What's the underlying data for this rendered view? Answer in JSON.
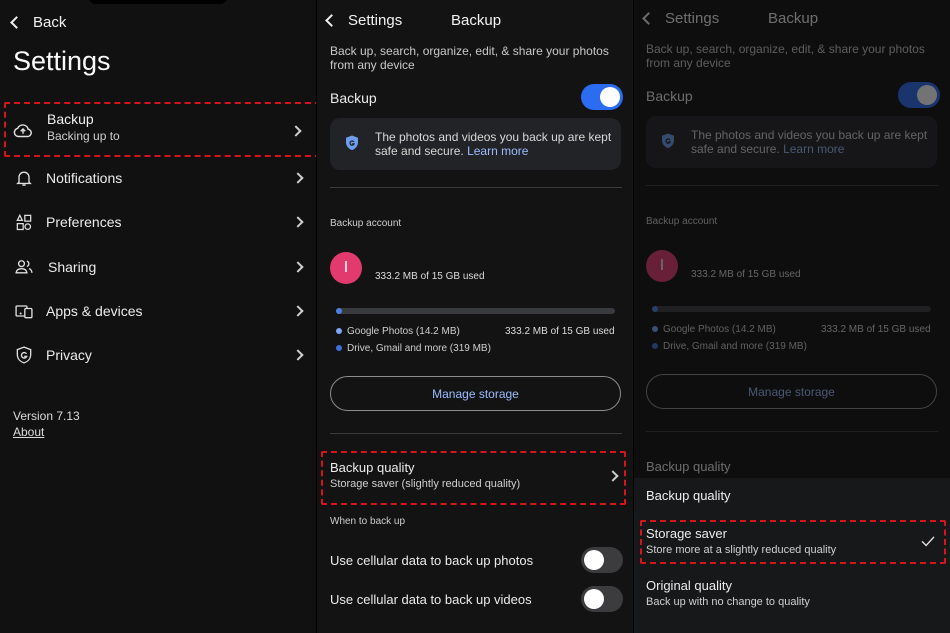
{
  "settings": {
    "back_label": "Back",
    "title": "Settings",
    "items": [
      {
        "label": "Backup",
        "sublabel": "Backing up to",
        "icon": "cloud-upload-icon"
      },
      {
        "label": "Notifications",
        "icon": "bell-icon"
      },
      {
        "label": "Preferences",
        "icon": "shapes-icon"
      },
      {
        "label": "Sharing",
        "icon": "people-icon"
      },
      {
        "label": "Apps & devices",
        "icon": "devices-icon"
      },
      {
        "label": "Privacy",
        "icon": "shield-g-icon"
      }
    ],
    "version": "Version 7.13",
    "about": "About"
  },
  "backup": {
    "back_label": "Settings",
    "title": "Backup",
    "description": "Back up, search, organize, edit, & share your photos from any device",
    "toggle_label": "Backup",
    "toggle_on": true,
    "info_text": "The photos and videos you back up are kept safe and secure.",
    "learn_more": "Learn more",
    "account_header": "Backup account",
    "avatar_letter": "I",
    "storage_used": "333.2 MB of 15 GB used",
    "usage_fraction": 0.02,
    "legend": [
      {
        "label": "Google Photos (14.2 MB)",
        "color": "#7fa6f5"
      },
      {
        "label": "Drive, Gmail and more (319 MB)",
        "color": "#3c6fd8"
      }
    ],
    "manage_storage": "Manage storage",
    "quality_title": "Backup quality",
    "quality_sub": "Storage saver (slightly reduced quality)",
    "when_header": "When to back up",
    "cellular_photos": "Use cellular data to back up photos",
    "cellular_videos": "Use cellular data to back up videos"
  },
  "sheet": {
    "title": "Backup quality",
    "options": [
      {
        "title": "Storage saver",
        "sub": "Store more at a slightly reduced quality",
        "selected": true
      },
      {
        "title": "Original quality",
        "sub": "Back up with no change to quality",
        "selected": false
      }
    ]
  },
  "colors": {
    "accent": "#2b6cf0",
    "highlight": "#d7141a",
    "link": "#9cbcff",
    "avatar": "#e23a6e"
  }
}
